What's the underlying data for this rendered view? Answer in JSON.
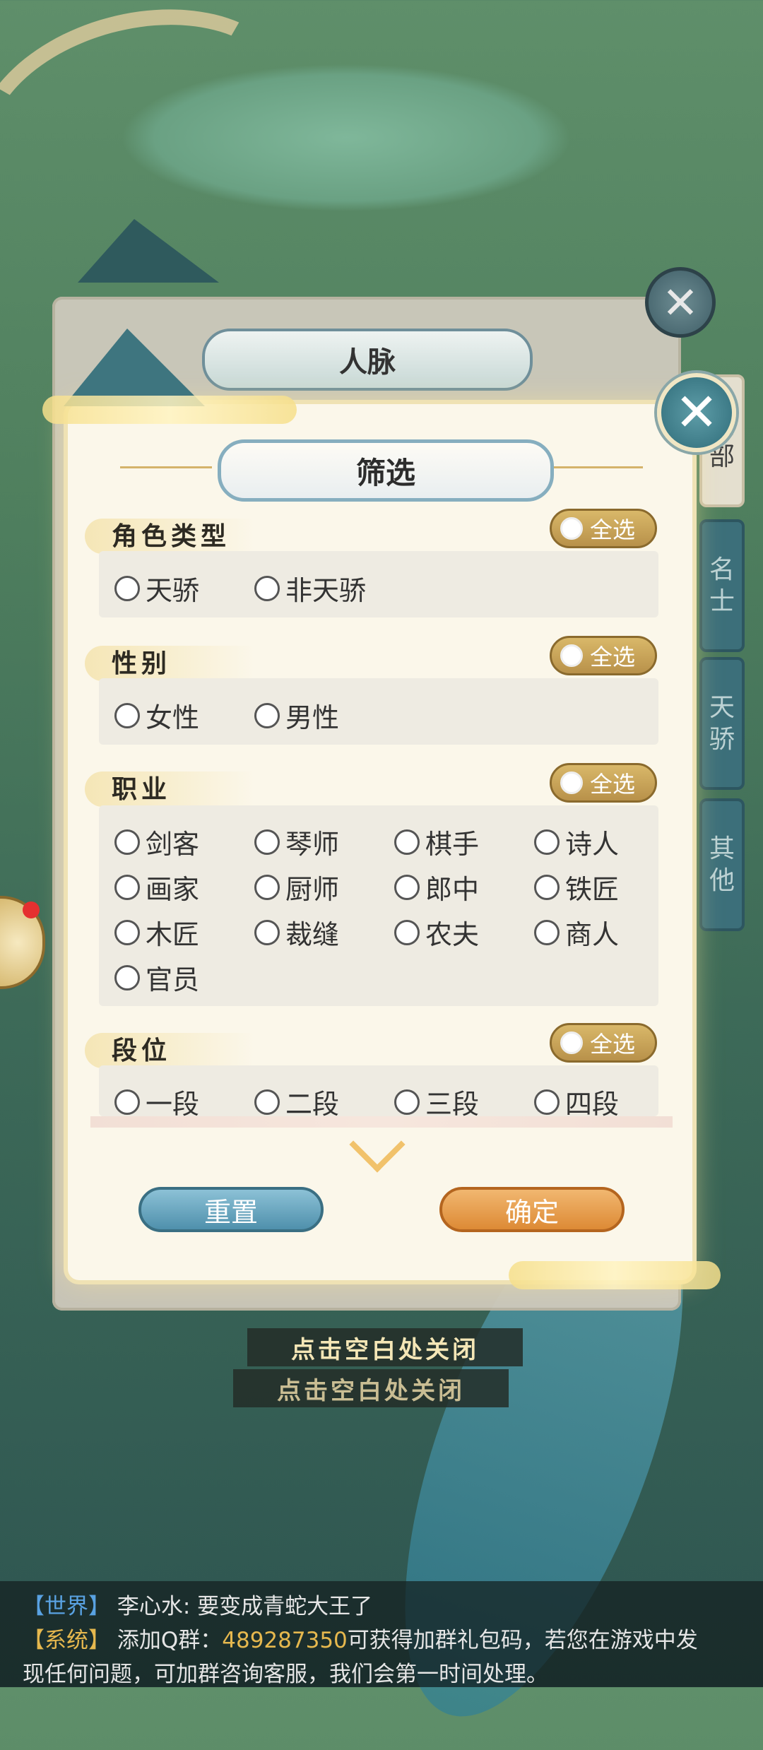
{
  "under_panel": {
    "title": "人脉",
    "side_tabs": [
      "全部",
      "名士",
      "天骄",
      "其他"
    ]
  },
  "modal": {
    "title": "筛选",
    "select_all_label": "全选",
    "sections": [
      {
        "label": "角色类型",
        "options": [
          "天骄",
          "非天骄"
        ]
      },
      {
        "label": "性别",
        "options": [
          "女性",
          "男性"
        ]
      },
      {
        "label": "职业",
        "options": [
          "剑客",
          "琴师",
          "棋手",
          "诗人",
          "画家",
          "厨师",
          "郎中",
          "铁匠",
          "木匠",
          "裁缝",
          "农夫",
          "商人",
          "官员"
        ]
      },
      {
        "label": "段位",
        "options": [
          "一段",
          "二段",
          "三段",
          "四段"
        ]
      }
    ],
    "reset_label": "重置",
    "confirm_label": "确定"
  },
  "close_hints": [
    "点击空白处关闭",
    "点击空白处关闭"
  ],
  "chat": {
    "line1": {
      "tag": "【世界】",
      "text": "李心水: 要变成青蛇大王了"
    },
    "line2": {
      "tag": "【系统】",
      "text_before": "添加Q群：",
      "qq": "489287350",
      "text_after": "可获得加群礼包码，若您在游戏中发"
    },
    "line3": {
      "text": "现任何问题，可加群咨询客服，我们会第一时间处理。"
    }
  },
  "colors": {
    "accent_gold": "#d9b869",
    "accent_blue": "#4f90ac",
    "accent_orange": "#dd8a35"
  }
}
